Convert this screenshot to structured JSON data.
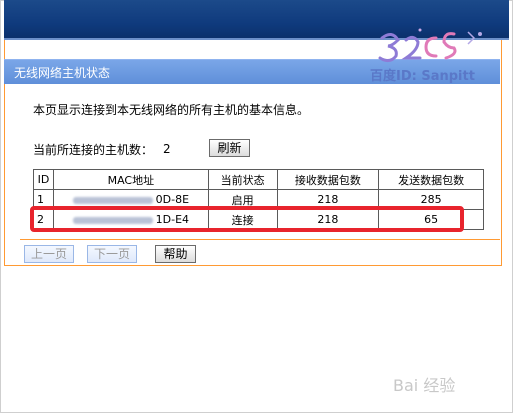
{
  "panel": {
    "title": "无线网络主机状态",
    "description": "本页显示连接到本无线网络的所有主机的基本信息。",
    "host_count_label": "当前所连接的主机数：",
    "host_count": "2",
    "refresh_label": "刷新"
  },
  "table": {
    "headers": [
      "ID",
      "MAC地址",
      "当前状态",
      "接收数据包数",
      "发送数据包数"
    ],
    "rows": [
      {
        "id": "1",
        "mac_visible": "0D-8E",
        "status": "启用",
        "rx": "218",
        "tx": "285"
      },
      {
        "id": "2",
        "mac_visible": "1D-E4",
        "status": "连接",
        "rx": "218",
        "tx": "65"
      }
    ]
  },
  "footer": {
    "prev_label": "上一页",
    "next_label": "下一页",
    "help_label": "帮助"
  },
  "overlay": {
    "logo_text": "百度ID: Sanpitt",
    "watermark": "Bai 经验"
  },
  "colors": {
    "header_blue": "#6a97dc",
    "top_band": "#123f80",
    "panel_border": "#ff9a33",
    "highlight": "#e8242d"
  }
}
